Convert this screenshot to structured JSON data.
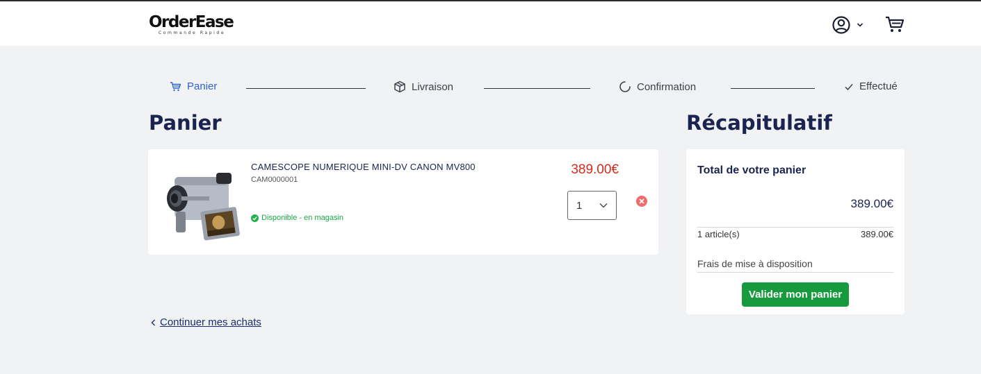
{
  "header": {
    "logo_main": "OrderEase",
    "logo_sub": "Commande Rapide",
    "user_icon": "user-circle-icon",
    "cart_icon": "cart-icon"
  },
  "stepper": {
    "steps": [
      {
        "label": "Panier",
        "icon": "cart-icon",
        "state": "active"
      },
      {
        "label": "Livraison",
        "icon": "box-icon",
        "state": "pending"
      },
      {
        "label": "Confirmation",
        "icon": "spinner-icon",
        "state": "pending"
      },
      {
        "label": "Effectué",
        "icon": "check-icon",
        "state": "pending"
      }
    ]
  },
  "cart": {
    "title": "Panier",
    "items": [
      {
        "name": "CAMESCOPE NUMERIQUE MINI-DV CANON MV800",
        "ref": "CAM0000001",
        "availability": "Disponible - en magasin",
        "price": "389.00€",
        "quantity": "1"
      }
    ],
    "continue_label": "Continuer mes achats"
  },
  "summary": {
    "title": "Récapitulatif",
    "card_title": "Total de votre panier",
    "total": "389.00€",
    "count_label": "1 article(s)",
    "count_value": "389.00€",
    "fees_label": "Frais de mise à disposition",
    "validate_label": "Valider mon panier"
  },
  "colors": {
    "accent": "#2b63c8",
    "price": "#d8281c",
    "success": "#179a3d",
    "navy": "#1b2350",
    "background": "#f1f2f4"
  }
}
